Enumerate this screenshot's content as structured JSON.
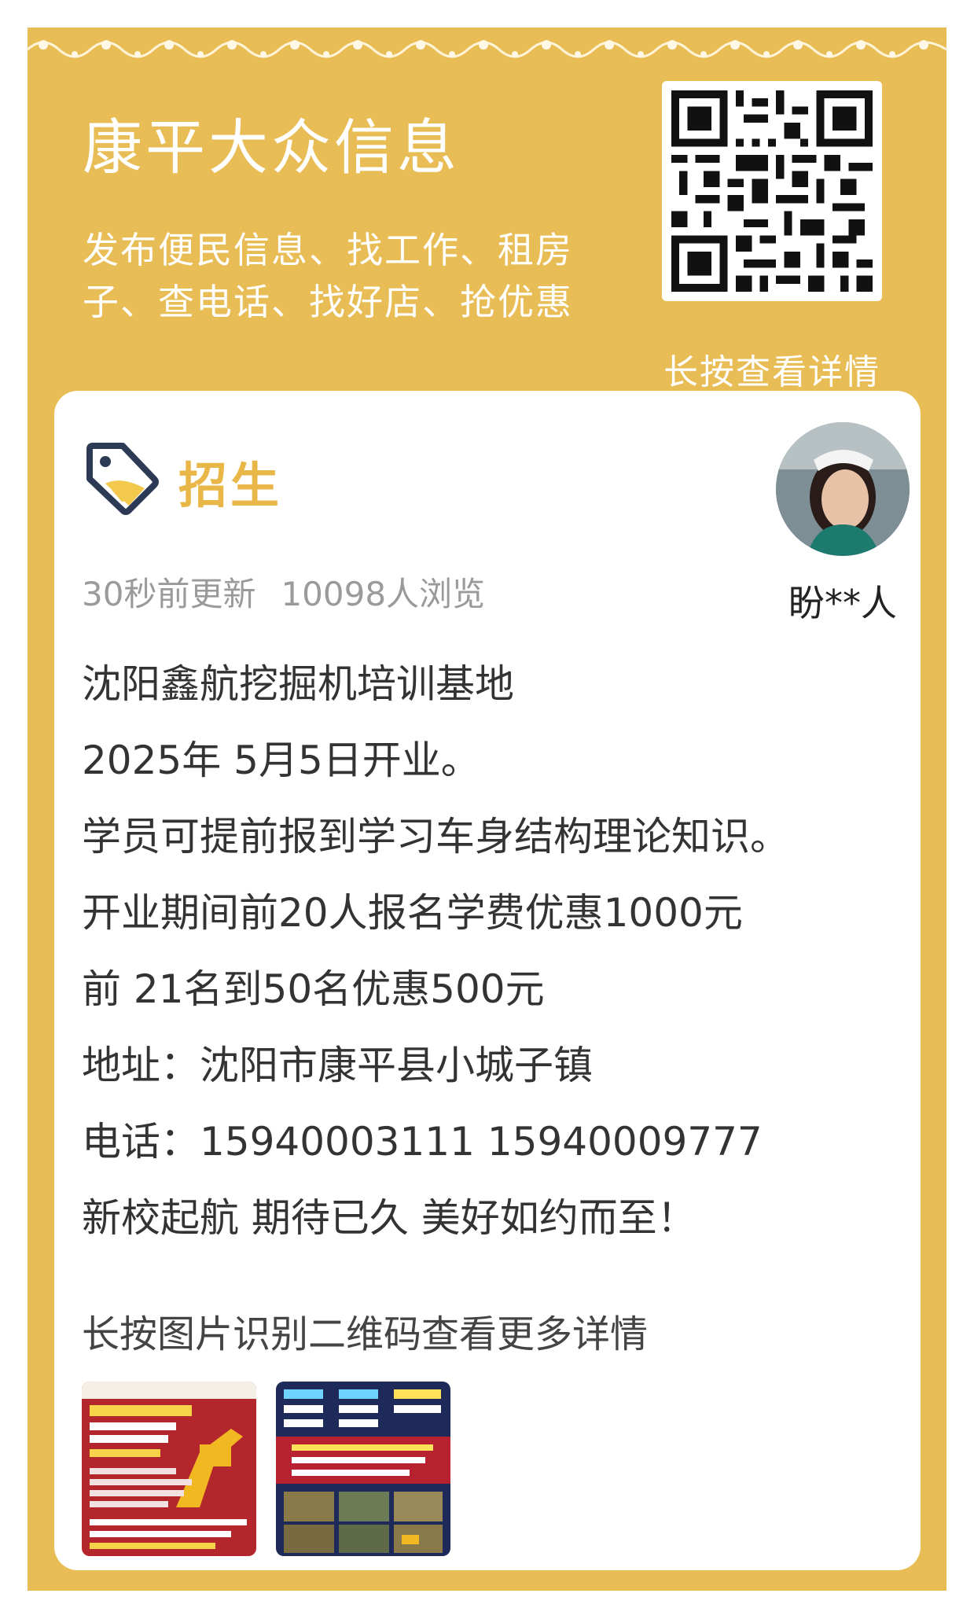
{
  "header": {
    "title": "康平大众信息",
    "subtitle": "发布便民信息、找工作、租房子、查电话、找好店、抢优惠",
    "qr_caption": "长按查看详情"
  },
  "post": {
    "category": "招生",
    "updated": "30秒前更新",
    "views": "10098人浏览",
    "author": "盼**人",
    "lines": [
      "沈阳鑫航挖掘机培训基地",
      "2025年 5月5日开业。",
      "学员可提前报到学习车身结构理论知识。",
      "开业期间前20人报名学费优惠1000元",
      "前 21名到50名优惠500元",
      "地址：沈阳市康平县小城子镇",
      "电话：15940003111  15940009777",
      "新校起航 期待已久 美好如约而至！"
    ],
    "hint": "长按图片识别二维码查看更多详情"
  },
  "theme": {
    "accent": "#e9bd55",
    "tag_color": "#e9b748"
  }
}
